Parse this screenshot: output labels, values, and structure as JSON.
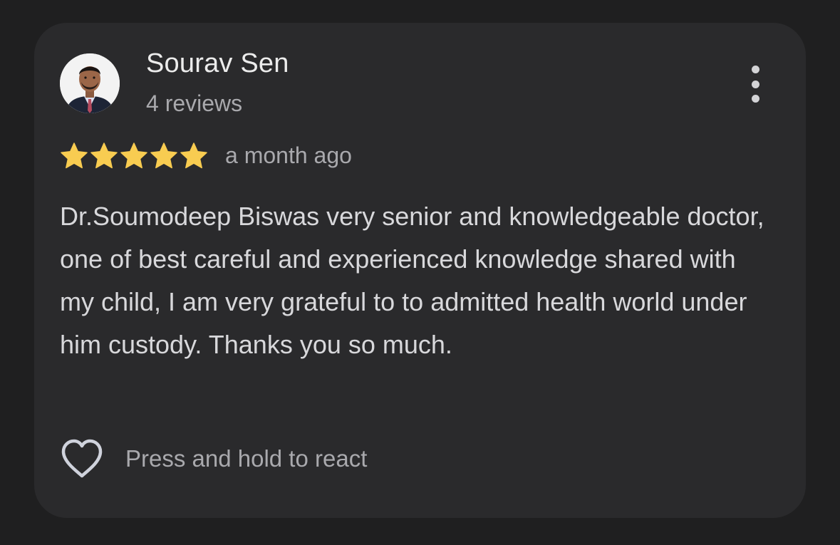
{
  "review": {
    "reviewer_name": "Sourav Sen",
    "review_count": "4 reviews",
    "rating": 5,
    "rating_max": 5,
    "time_ago": "a month ago",
    "text": "Dr.Soumodeep Biswas very senior and knowledgeable doctor, one of best careful and experienced knowledge shared with my child, I am very grateful to to admitted health world under him custody. Thanks you so much.",
    "react_prompt": "Press and hold to react"
  },
  "icons": {
    "avatar": "avatar-photo",
    "menu": "more-vertical-icon",
    "star": "star-icon",
    "react": "heart-outline-icon"
  },
  "colors": {
    "background": "#1f1f20",
    "card": "#2a2a2c",
    "star": "#f8cc51",
    "primary_text": "#ececec",
    "secondary_text": "#a9a9ad"
  }
}
